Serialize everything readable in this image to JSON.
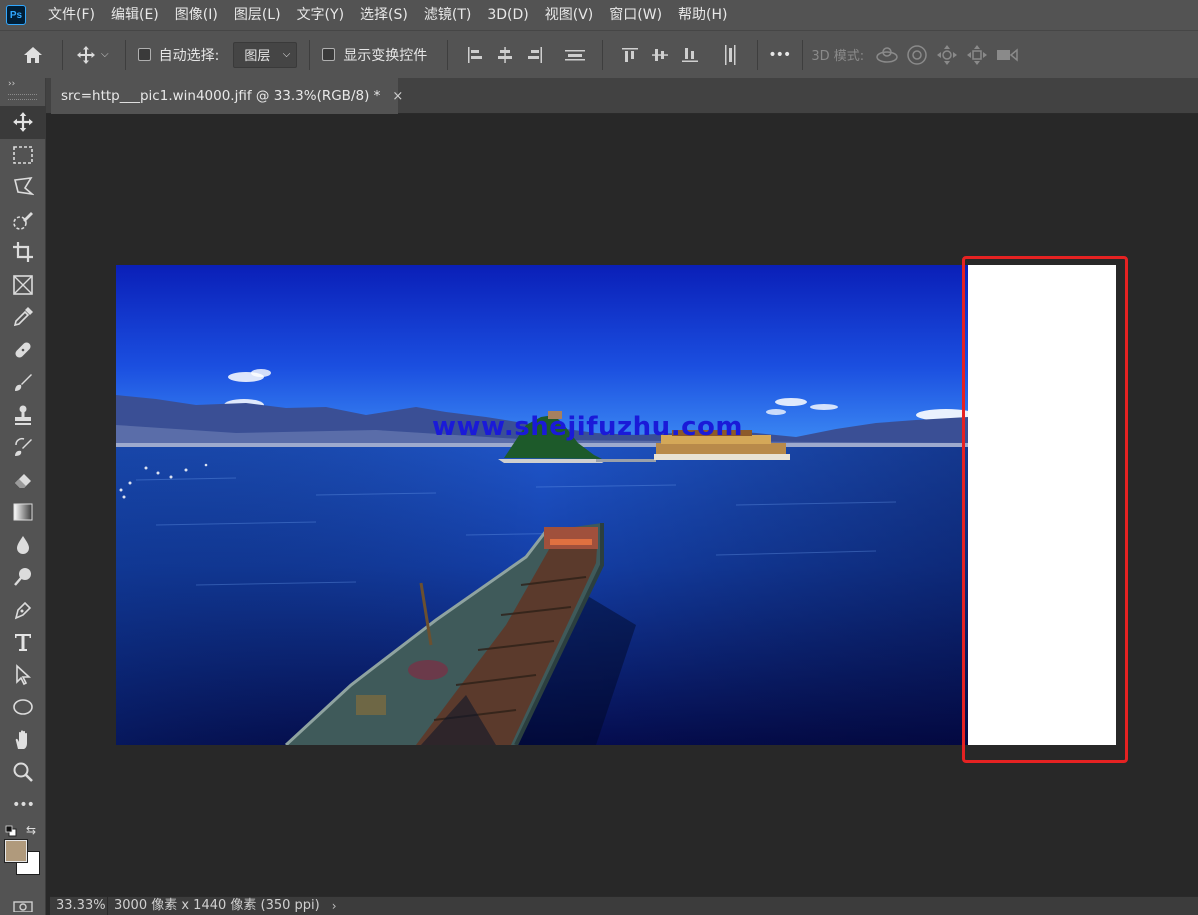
{
  "app": {
    "logo_text": "Ps"
  },
  "menu": [
    {
      "label": "文件(F)"
    },
    {
      "label": "编辑(E)"
    },
    {
      "label": "图像(I)"
    },
    {
      "label": "图层(L)"
    },
    {
      "label": "文字(Y)"
    },
    {
      "label": "选择(S)"
    },
    {
      "label": "滤镜(T)"
    },
    {
      "label": "3D(D)"
    },
    {
      "label": "视图(V)"
    },
    {
      "label": "窗口(W)"
    },
    {
      "label": "帮助(H)"
    }
  ],
  "options": {
    "auto_select_label": "自动选择:",
    "auto_select_checked": false,
    "layer_select_value": "图层",
    "show_transform_label": "显示变换控件",
    "show_transform_checked": false,
    "more_label": "•••",
    "mode_3d_label": "3D 模式:"
  },
  "document": {
    "tab_title": "src=http___pic1.win4000.jfif @ 33.3%(RGB/8) *",
    "close_glyph": "×",
    "watermark": "www.shejifuzhu.com"
  },
  "toolbar": {
    "collapse_glyph": "››",
    "more_label": "•••",
    "swap_glyph": "⇆",
    "colors": {
      "foreground": "#b09a7c",
      "background": "#ffffff"
    }
  },
  "status": {
    "zoom": "33.33%",
    "doc_info": "3000 像素 x 1440 像素 (350 ppi)",
    "arrow": "›"
  },
  "colors": {
    "highlight": "#e52222",
    "accent": "#31a8ff"
  }
}
